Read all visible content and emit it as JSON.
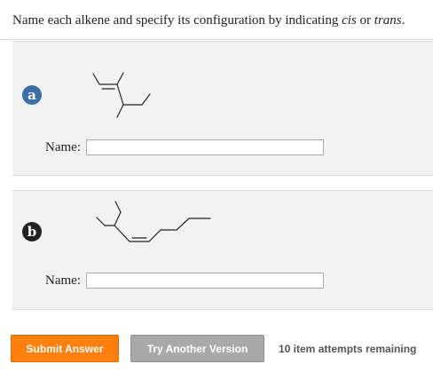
{
  "prompt": {
    "before": "Name each alkene and specify its configuration by indicating ",
    "cis": "cis",
    "middle": " or ",
    "trans": "trans",
    "after": "."
  },
  "questions": [
    {
      "badge": "a",
      "name_label": "Name:",
      "input_value": "",
      "badge_color": "#3d6fa6"
    },
    {
      "badge": "b",
      "name_label": "Name:",
      "input_value": "",
      "badge_color": "#222222"
    }
  ],
  "footer": {
    "submit_label": "Submit Answer",
    "try_label": "Try Another Version",
    "attempts_text": "10 item attempts remaining",
    "submit_color": "#ff7f0f",
    "try_color": "#a9a9a9"
  }
}
